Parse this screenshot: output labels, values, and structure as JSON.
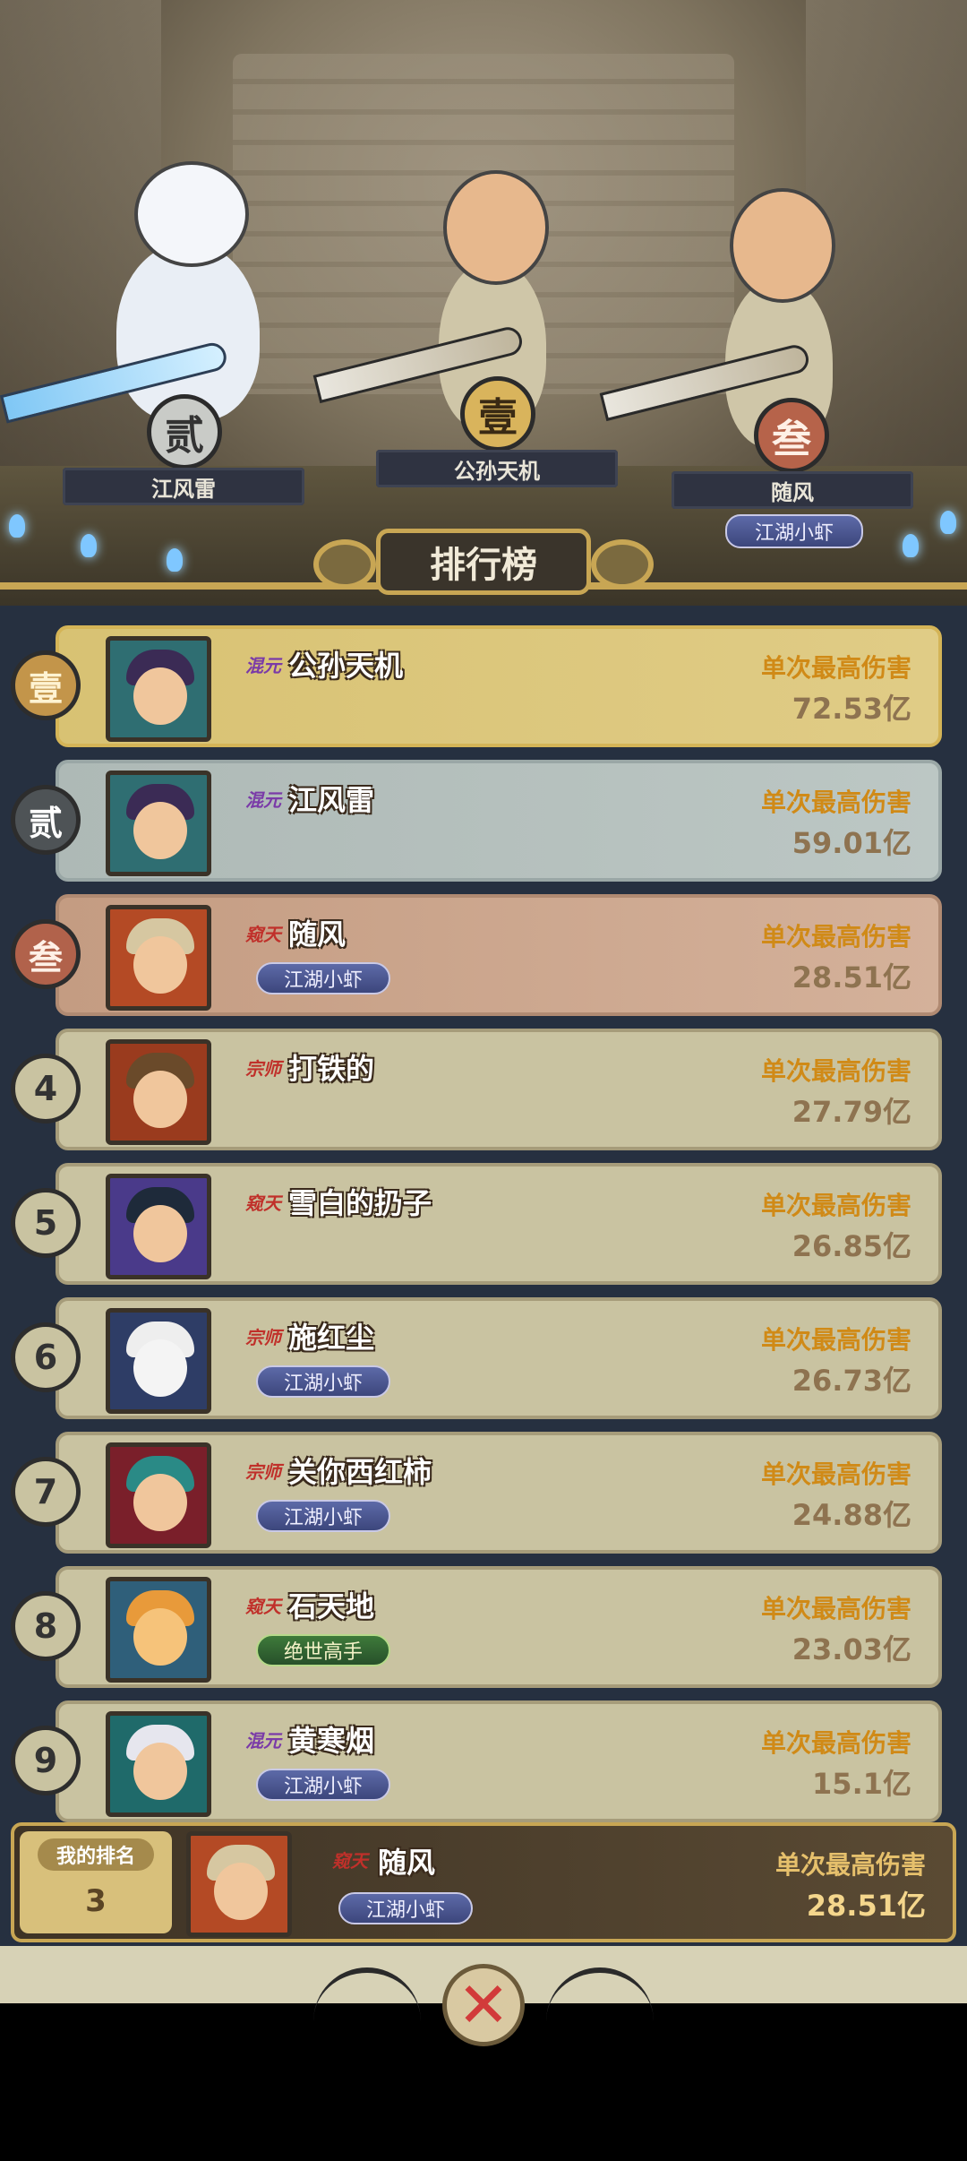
{
  "podium": [
    {
      "rank_glyph": "贰",
      "name": "江风雷",
      "title": ""
    },
    {
      "rank_glyph": "壹",
      "name": "公孙天机",
      "title": ""
    },
    {
      "rank_glyph": "叁",
      "name": "随风",
      "title": "江湖小虾"
    }
  ],
  "header": {
    "title": "排行榜"
  },
  "list": [
    {
      "rank": "壹",
      "sect": "混元",
      "name": "公孙天机",
      "title": "",
      "label": "单次最高伤害",
      "value": "72.53亿"
    },
    {
      "rank": "贰",
      "sect": "混元",
      "name": "江风雷",
      "title": "",
      "label": "单次最高伤害",
      "value": "59.01亿"
    },
    {
      "rank": "叁",
      "sect": "窥天",
      "name": "随风",
      "title": "江湖小虾",
      "label": "单次最高伤害",
      "value": "28.51亿"
    },
    {
      "rank": "4",
      "sect": "宗师",
      "name": "打铁的",
      "title": "",
      "label": "单次最高伤害",
      "value": "27.79亿"
    },
    {
      "rank": "5",
      "sect": "窥天",
      "name": "雪白的扔子",
      "title": "",
      "label": "单次最高伤害",
      "value": "26.85亿"
    },
    {
      "rank": "6",
      "sect": "宗师",
      "name": "施红尘",
      "title": "江湖小虾",
      "label": "单次最高伤害",
      "value": "26.73亿"
    },
    {
      "rank": "7",
      "sect": "宗师",
      "name": "关你西红柿",
      "title": "江湖小虾",
      "label": "单次最高伤害",
      "value": "24.88亿"
    },
    {
      "rank": "8",
      "sect": "窥天",
      "name": "石天地",
      "title": "绝世高手",
      "label": "单次最高伤害",
      "value": "23.03亿"
    },
    {
      "rank": "9",
      "sect": "混元",
      "name": "黄寒烟",
      "title": "江湖小虾",
      "label": "单次最高伤害",
      "value": "15.1亿"
    }
  ],
  "me": {
    "rank_label": "我的排名",
    "rank": "3",
    "sect": "窥天",
    "name": "随风",
    "title": "江湖小虾",
    "label": "单次最高伤害",
    "value": "28.51亿"
  },
  "close_icon": "x-icon",
  "colors": {
    "gold": "#c8a654",
    "damage_label": "#d08a17",
    "panel": "#263040"
  }
}
